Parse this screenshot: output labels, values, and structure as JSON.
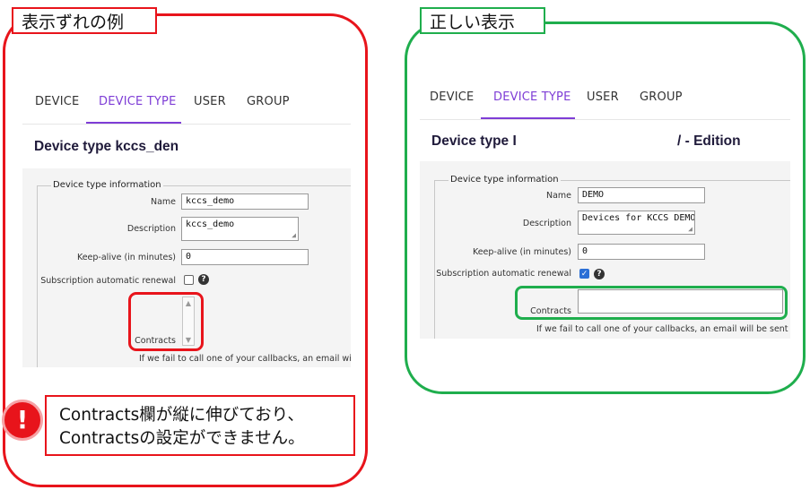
{
  "captions": {
    "wrong": "表示ずれの例",
    "correct": "正しい表示"
  },
  "tabs": [
    "DEVICE",
    "DEVICE TYPE",
    "USER",
    "GROUP"
  ],
  "colors": {
    "wrong": "#e8141b",
    "correct": "#1fae4d",
    "accent": "#7e3dd6"
  },
  "left": {
    "title": "Device type kccs_den",
    "section": "Device type information",
    "labels": {
      "name": "Name",
      "description": "Description",
      "keepalive": "Keep-alive (in minutes)",
      "renewal": "Subscription automatic renewal",
      "contracts": "Contracts"
    },
    "values": {
      "name": "kccs_demo",
      "description": "kccs_demo",
      "keepalive": "0"
    },
    "renewal_checked": false,
    "note": "If we fail to call one of your callbacks, an email will be"
  },
  "right": {
    "title_start": "Device type I",
    "title_end": "/ - Edition",
    "section": "Device type information",
    "labels": {
      "name": "Name",
      "description": "Description",
      "keepalive": "Keep-alive (in minutes)",
      "renewal": "Subscription automatic renewal",
      "contracts": "Contracts"
    },
    "values": {
      "name": "DEMO",
      "description": "Devices for KCCS DEMO",
      "keepalive": "0"
    },
    "renewal_checked": true,
    "note": "If we fail to call one of your callbacks, an email will be sent to the"
  },
  "warning": {
    "icon": "exclamation-icon",
    "line1": "Contracts欄が縦に伸びており、",
    "line2": "Contractsの設定ができません。"
  }
}
